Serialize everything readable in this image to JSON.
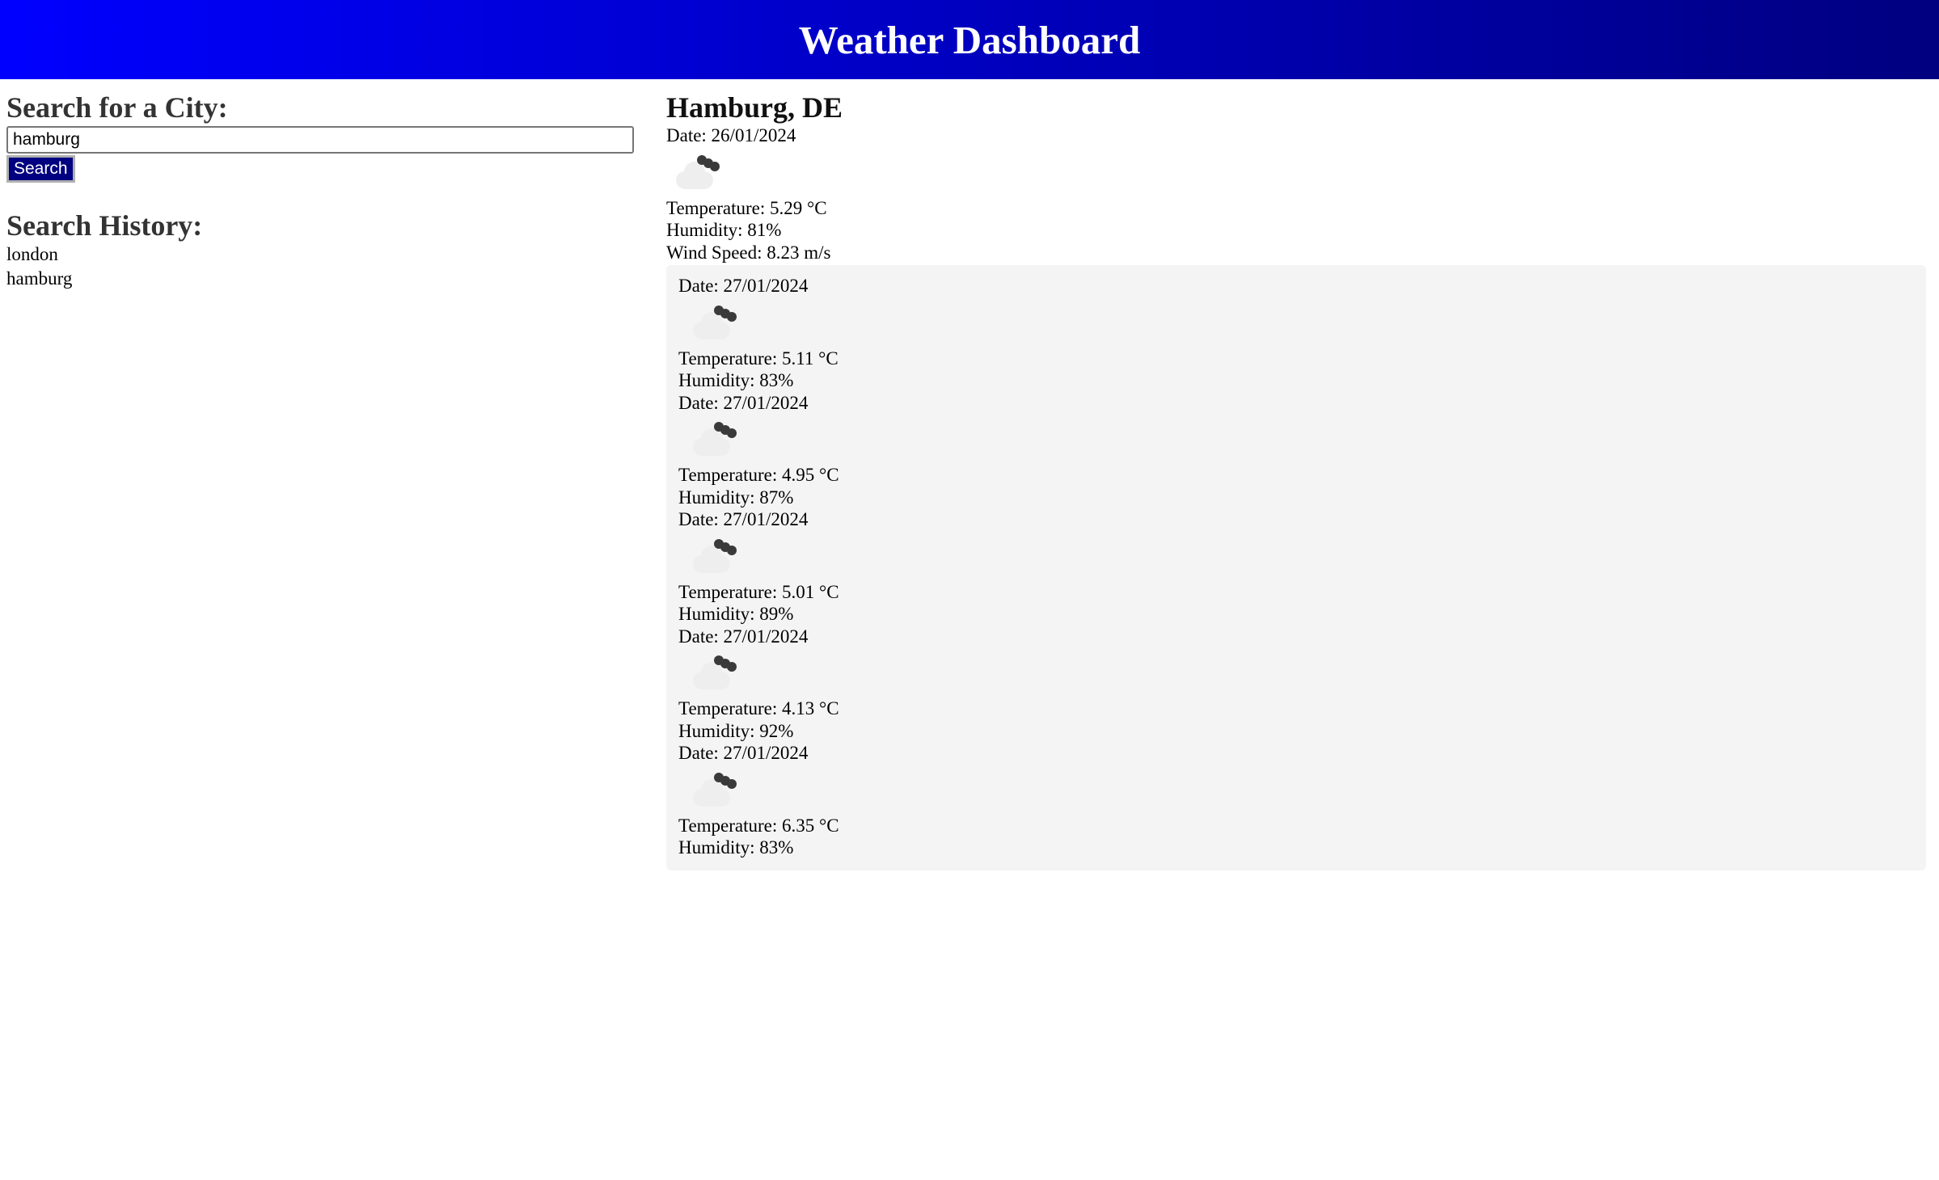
{
  "header": {
    "title": "Weather Dashboard"
  },
  "search": {
    "title": "Search for a City:",
    "input_value": "hamburg",
    "button_label": "Search"
  },
  "history": {
    "title": "Search History:",
    "items": [
      "london",
      "hamburg"
    ]
  },
  "current": {
    "city": "Hamburg, DE",
    "date": "Date: 26/01/2024",
    "icon": "cloudy-icon",
    "temperature": "Temperature: 5.29 °C",
    "humidity": "Humidity: 81%",
    "wind": "Wind Speed: 8.23 m/s"
  },
  "forecast": [
    {
      "date": "Date: 27/01/2024",
      "icon": "cloudy-icon",
      "temperature": "Temperature: 5.11 °C",
      "humidity": "Humidity: 83%"
    },
    {
      "date": "Date: 27/01/2024",
      "icon": "cloudy-icon",
      "temperature": "Temperature: 4.95 °C",
      "humidity": "Humidity: 87%"
    },
    {
      "date": "Date: 27/01/2024",
      "icon": "cloudy-icon",
      "temperature": "Temperature: 5.01 °C",
      "humidity": "Humidity: 89%"
    },
    {
      "date": "Date: 27/01/2024",
      "icon": "cloudy-icon",
      "temperature": "Temperature: 4.13 °C",
      "humidity": "Humidity: 92%"
    },
    {
      "date": "Date: 27/01/2024",
      "icon": "cloudy-icon",
      "temperature": "Temperature: 6.35 °C",
      "humidity": "Humidity: 83%"
    }
  ],
  "colors": {
    "header_gradient_start": "#0000ff",
    "header_gradient_end": "#000080",
    "button_bg": "#000080",
    "forecast_bg": "#f4f4f4"
  }
}
